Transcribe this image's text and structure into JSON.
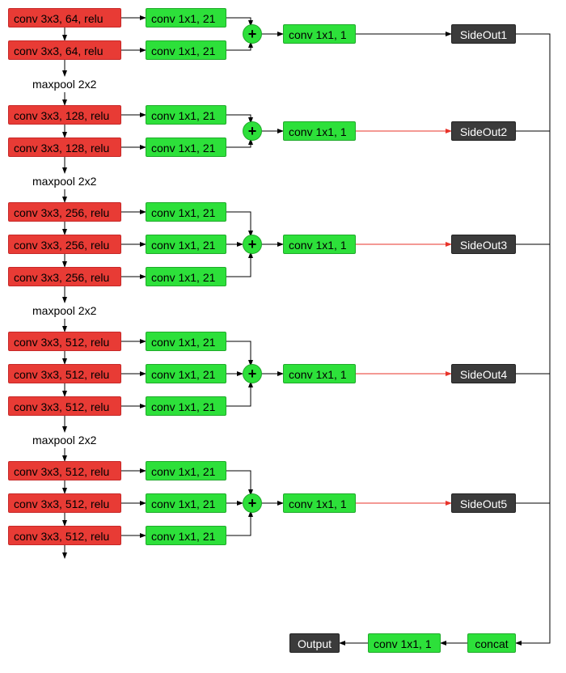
{
  "conv": {
    "c64": "conv 3x3, 64, relu",
    "c128": "conv 3x3, 128, relu",
    "c256": "conv 3x3, 256, relu",
    "c512": "conv 3x3, 512, relu",
    "c1x1_21": "conv 1x1, 21",
    "c1x1_1": "conv 1x1, 1"
  },
  "pool": "maxpool 2x2",
  "sides": [
    "SideOut1",
    "SideOut2",
    "SideOut3",
    "SideOut4",
    "SideOut5"
  ],
  "output": "Output",
  "concat": "concat",
  "plus": "+",
  "colors": {
    "red": "#e83b35",
    "green": "#2de03a",
    "dark": "#3b3b3b",
    "link": "#000",
    "redlink": "#e8332a"
  }
}
